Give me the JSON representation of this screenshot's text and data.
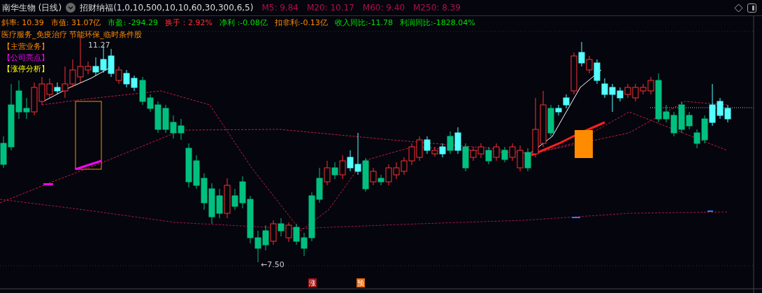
{
  "header": {
    "title": "南华生物 (日线)",
    "indicator": "招财纳福(1,0,10,500,10,10,60,30,300,6,5)",
    "averages": [
      "M5: 9.84",
      "M20: 10.17",
      "M60: 9.40",
      "M250: 8.39"
    ]
  },
  "metrics": [
    {
      "text": "斜率: 10.39",
      "color": "#ff8c00"
    },
    {
      "text": "市值: 31.07亿",
      "color": "#ff8c00"
    },
    {
      "text": "市盈: -294.29",
      "color": "#00e000"
    },
    {
      "text": "换手：2.92%",
      "color": "#ff3030"
    },
    {
      "text": "净利 :-0.08亿",
      "color": "#00e000"
    },
    {
      "text": "扣非利:-0.13亿",
      "color": "#ff8c00"
    },
    {
      "text": "收入同比:-11.78",
      "color": "#00e000"
    },
    {
      "text": "利润同比:-1828.04%",
      "color": "#00e000"
    }
  ],
  "concepts": "医疗服务_免疫治疗 节能环保_临时条件股",
  "sections": [
    {
      "text": "【主营业务】",
      "color": "#ff8c00"
    },
    {
      "text": "【公司亮点】",
      "color": "#ff00ff"
    },
    {
      "text": "【涨停分析】",
      "color": "#ffff00"
    }
  ],
  "chart": {
    "high_label": "11.27",
    "low_label": "←7.50"
  },
  "markers": [
    {
      "text": "涨",
      "color": "#a01010"
    },
    {
      "text": "预",
      "color": "#e06000"
    }
  ]
}
